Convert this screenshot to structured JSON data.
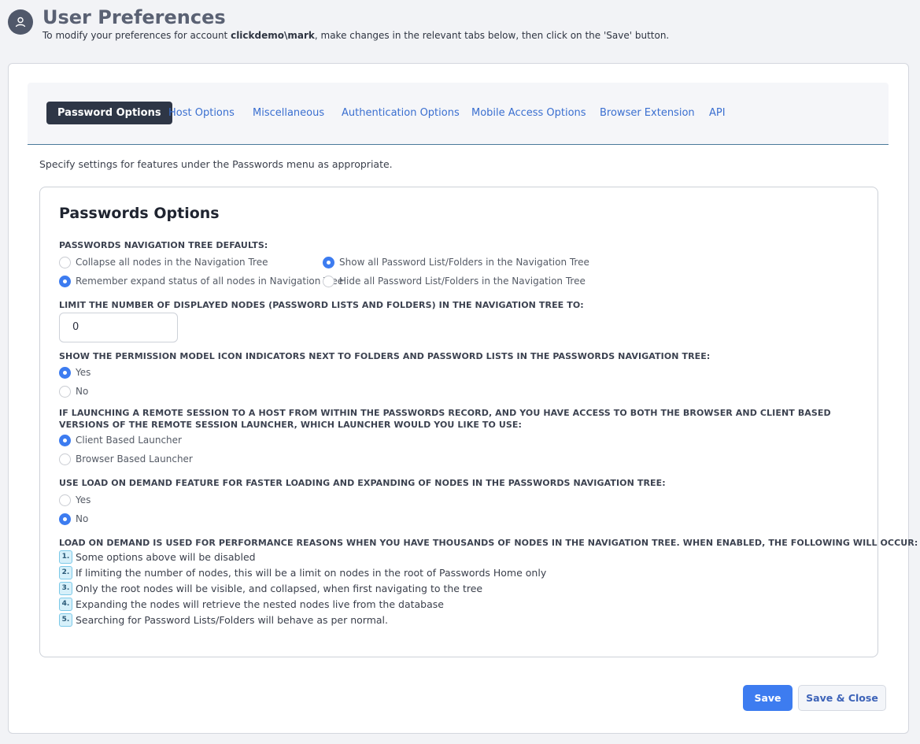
{
  "header": {
    "title": "User Preferences",
    "subtitle_prefix": "To modify your preferences for account ",
    "account": "clickdemo\\mark",
    "subtitle_suffix": ", make changes in the relevant tabs below, then click on the 'Save' button.",
    "avatar_icon": "user-icon"
  },
  "tabs": [
    {
      "label": "Password Options",
      "active": true
    },
    {
      "label": "Host Options",
      "active": false
    },
    {
      "label": "Miscellaneous",
      "active": false
    },
    {
      "label": "Authentication Options",
      "active": false
    },
    {
      "label": "Mobile Access Options",
      "active": false
    },
    {
      "label": "Browser Extension",
      "active": false
    },
    {
      "label": "API",
      "active": false
    }
  ],
  "intro": "Specify settings for features under the Passwords menu as appropriate.",
  "panel": {
    "title": "Passwords Options",
    "nav_tree_defaults": {
      "label": "PASSWORDS NAVIGATION TREE DEFAULTS:",
      "options": [
        {
          "label": "Collapse all nodes in the Navigation Tree",
          "checked": false
        },
        {
          "label": "Remember expand status of all nodes in Navigation Tree",
          "checked": true
        },
        {
          "label": "Show all Password List/Folders in the Navigation Tree",
          "checked": true
        },
        {
          "label": "Hide all Password List/Folders in the Navigation Tree",
          "checked": false
        }
      ]
    },
    "limit_nodes": {
      "label": "LIMIT THE NUMBER OF DISPLAYED NODES (PASSWORD LISTS AND FOLDERS) IN THE NAVIGATION TREE TO:",
      "value": "0"
    },
    "permission_icons": {
      "label": "SHOW THE PERMISSION MODEL ICON INDICATORS NEXT TO FOLDERS AND PASSWORD LISTS IN THE PASSWORDS NAVIGATION TREE:",
      "options": [
        {
          "label": "Yes",
          "checked": true
        },
        {
          "label": "No",
          "checked": false
        }
      ]
    },
    "launcher": {
      "label": "IF LAUNCHING A REMOTE SESSION TO A HOST FROM WITHIN THE PASSWORDS RECORD, AND YOU HAVE ACCESS TO BOTH THE BROWSER AND CLIENT BASED VERSIONS OF THE REMOTE SESSION LAUNCHER, WHICH LAUNCHER WOULD YOU LIKE TO USE:",
      "options": [
        {
          "label": "Client Based Launcher",
          "checked": true
        },
        {
          "label": "Browser Based Launcher",
          "checked": false
        }
      ]
    },
    "load_on_demand": {
      "label": "USE LOAD ON DEMAND FEATURE FOR FASTER LOADING AND EXPANDING OF NODES IN THE PASSWORDS NAVIGATION TREE:",
      "options": [
        {
          "label": "Yes",
          "checked": false
        },
        {
          "label": "No",
          "checked": true
        }
      ]
    },
    "load_on_demand_info": {
      "label": "LOAD ON DEMAND IS USED FOR PERFORMANCE REASONS WHEN YOU HAVE THOUSANDS OF NODES IN THE NAVIGATION TREE. WHEN ENABLED, THE FOLLOWING WILL OCCUR:",
      "items": [
        {
          "num": "1.",
          "text": "Some options above will be disabled"
        },
        {
          "num": "2.",
          "text": "If limiting the number of nodes, this will be a limit on nodes in the root of Passwords Home only"
        },
        {
          "num": "3.",
          "text": "Only the root nodes will be visible, and collapsed, when first navigating to the tree"
        },
        {
          "num": "4.",
          "text": "Expanding the nodes will retrieve the nested nodes live from the database"
        },
        {
          "num": "5.",
          "text": "Searching for Password Lists/Folders will behave as per normal."
        }
      ]
    }
  },
  "buttons": {
    "save": "Save",
    "save_close": "Save & Close"
  },
  "colors": {
    "accent": "#3d7cf0",
    "active_tab_bg": "#2e3646",
    "tab_link": "#3a6fd0"
  }
}
